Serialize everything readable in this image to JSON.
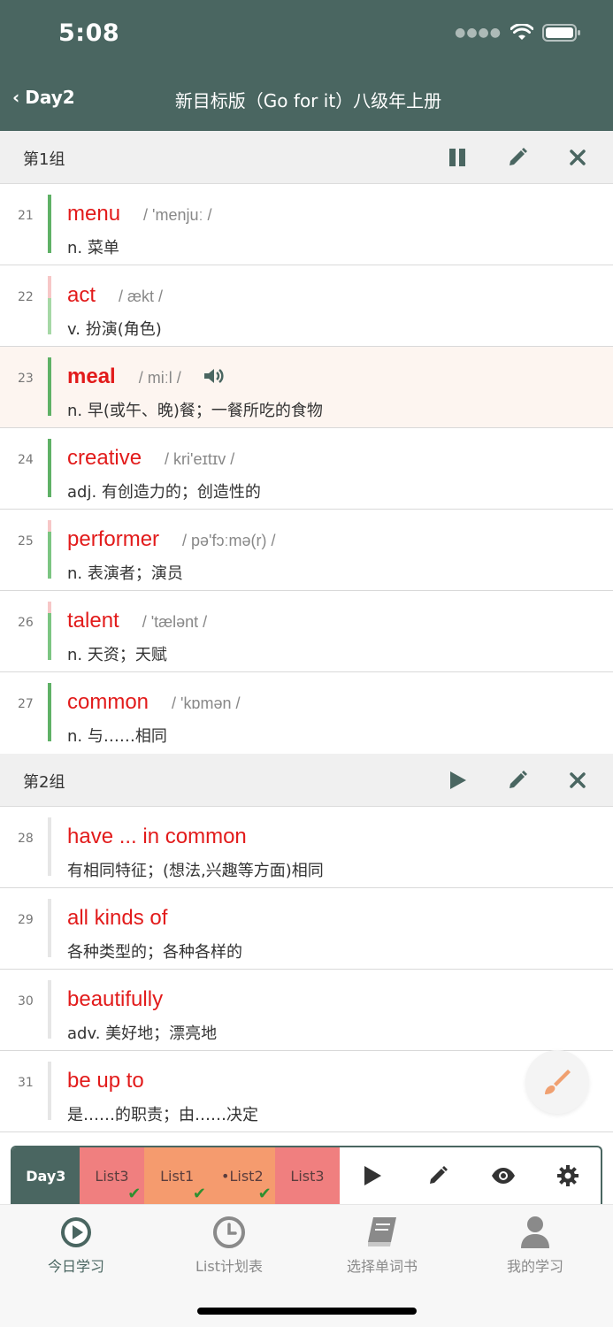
{
  "status": {
    "time": "5:08"
  },
  "nav": {
    "back_label": "Day2",
    "title": "新目标版（Go for it）八级年上册"
  },
  "groups": [
    {
      "title": "第1组",
      "words": [
        {
          "index": "21",
          "word": "menu",
          "phonetic": "/ 'menjuː /",
          "definition": "n. 菜单"
        },
        {
          "index": "22",
          "word": "act",
          "phonetic": "/ ækt /",
          "definition": "v. 扮演(角色)"
        },
        {
          "index": "23",
          "word": "meal",
          "phonetic": "/ miːl /",
          "definition": "n. 早(或午、晚)餐；一餐所吃的食物"
        },
        {
          "index": "24",
          "word": "creative",
          "phonetic": "/ kri'eɪtɪv /",
          "definition": "adj. 有创造力的；创造性的"
        },
        {
          "index": "25",
          "word": "performer",
          "phonetic": "/ pə'fɔːmə(r) /",
          "definition": "n. 表演者；演员"
        },
        {
          "index": "26",
          "word": "talent",
          "phonetic": "/ 'tælənt /",
          "definition": "n. 天资；天赋"
        },
        {
          "index": "27",
          "word": "common",
          "phonetic": "/ 'kɒmən /",
          "definition": "n. 与……相同"
        }
      ]
    },
    {
      "title": "第2组",
      "words": [
        {
          "index": "28",
          "word": "have ... in common",
          "phonetic": "",
          "definition": " 有相同特征；(想法,兴趣等方面)相同"
        },
        {
          "index": "29",
          "word": "all kinds of",
          "phonetic": "",
          "definition": " 各种类型的；各种各样的"
        },
        {
          "index": "30",
          "word": "beautifully",
          "phonetic": "",
          "definition": "adv. 美好地；漂亮地"
        },
        {
          "index": "31",
          "word": "be up to",
          "phonetic": "",
          "definition": " 是……的职责；由……决定"
        }
      ]
    }
  ],
  "player": {
    "day": "Day3",
    "lists": [
      {
        "label": "List3",
        "color": "#f07f7f",
        "checked": true
      },
      {
        "label": "List1",
        "color": "#f59b6e",
        "checked": true
      },
      {
        "label": "•List2",
        "color": "#f59b6e",
        "checked": true
      },
      {
        "label": "List3",
        "color": "#f07f7f",
        "checked": false
      }
    ],
    "controls": [
      "play-icon",
      "pencil-icon",
      "eye-icon",
      "gear-icon"
    ]
  },
  "tabs": [
    {
      "label": "今日学习",
      "icon": "play-circle-icon",
      "active": true
    },
    {
      "label": "List计划表",
      "icon": "clock-icon",
      "active": false
    },
    {
      "label": "选择单词书",
      "icon": "book-icon",
      "active": false
    },
    {
      "label": "我的学习",
      "icon": "person-icon",
      "active": false
    }
  ],
  "colors": {
    "header": "#4a6661",
    "word": "#e21b1b",
    "highlight_row": "#fdf5f0",
    "progress_green": "#5fb166"
  }
}
